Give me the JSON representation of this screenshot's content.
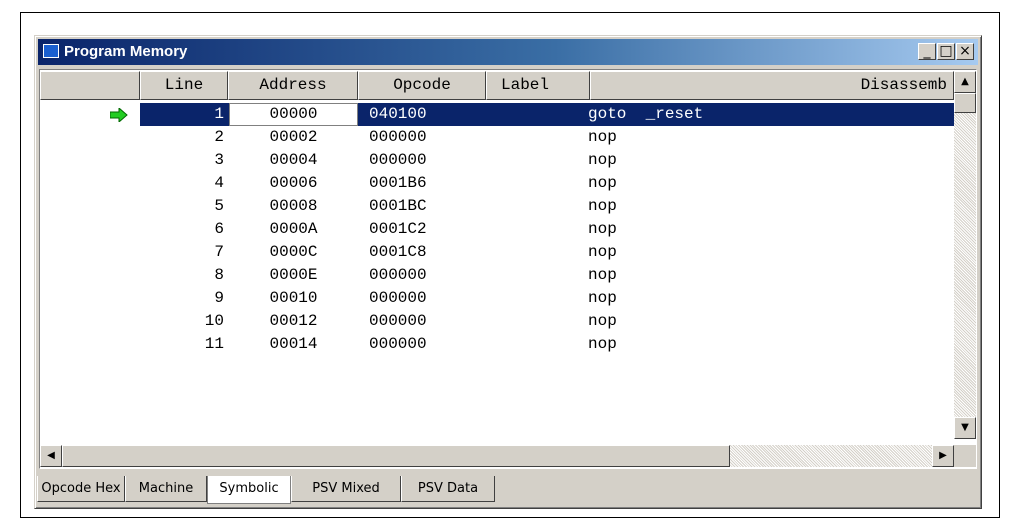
{
  "window": {
    "title": "Program Memory",
    "controls": {
      "minimize": "_",
      "maximize": "□",
      "close": "×"
    }
  },
  "columns": [
    "",
    "Line",
    "Address",
    "Opcode",
    "Label",
    "Disassemb"
  ],
  "rows": [
    {
      "line": "1",
      "address": "00000",
      "opcode": "040100",
      "label": "",
      "disasm": "goto  _reset",
      "current": true
    },
    {
      "line": "2",
      "address": "00002",
      "opcode": "000000",
      "label": "",
      "disasm": "nop"
    },
    {
      "line": "3",
      "address": "00004",
      "opcode": "000000",
      "label": "",
      "disasm": "nop"
    },
    {
      "line": "4",
      "address": "00006",
      "opcode": "0001B6",
      "label": "",
      "disasm": "nop"
    },
    {
      "line": "5",
      "address": "00008",
      "opcode": "0001BC",
      "label": "",
      "disasm": "nop"
    },
    {
      "line": "6",
      "address": "0000A",
      "opcode": "0001C2",
      "label": "",
      "disasm": "nop"
    },
    {
      "line": "7",
      "address": "0000C",
      "opcode": "0001C8",
      "label": "",
      "disasm": "nop"
    },
    {
      "line": "8",
      "address": "0000E",
      "opcode": "000000",
      "label": "",
      "disasm": "nop"
    },
    {
      "line": "9",
      "address": "00010",
      "opcode": "000000",
      "label": "",
      "disasm": "nop"
    },
    {
      "line": "10",
      "address": "00012",
      "opcode": "000000",
      "label": "",
      "disasm": "nop"
    },
    {
      "line": "11",
      "address": "00014",
      "opcode": "000000",
      "label": "",
      "disasm": "nop"
    }
  ],
  "tabs": [
    {
      "label": "Opcode Hex",
      "active": false
    },
    {
      "label": "Machine",
      "active": false
    },
    {
      "label": "Symbolic",
      "active": true
    },
    {
      "label": "PSV Mixed",
      "active": false
    },
    {
      "label": "PSV Data",
      "active": false
    }
  ],
  "scroll": {
    "up": "▲",
    "down": "▼",
    "left": "◀",
    "right": "▶"
  },
  "colors": {
    "selection": "#0a246a",
    "pc_arrow": "#22cc22",
    "chrome": "#d4d0c8"
  },
  "icons": {
    "pc_marker": "green-right-arrow-icon",
    "window": "window-icon"
  }
}
